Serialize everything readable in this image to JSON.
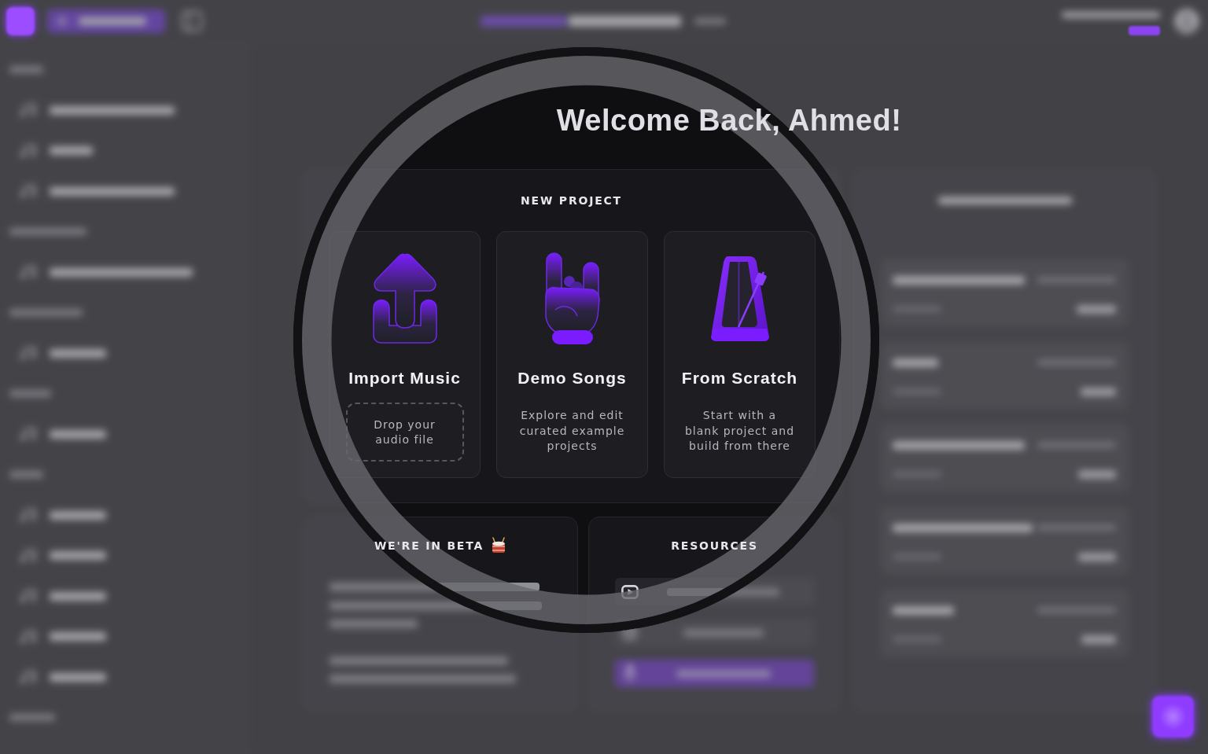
{
  "sidebar": {
    "rows": [
      {
        "kind": "label"
      },
      {
        "kind": "song"
      },
      {
        "kind": "song"
      },
      {
        "kind": "song"
      },
      {
        "kind": "label"
      },
      {
        "kind": "song"
      },
      {
        "kind": "label"
      },
      {
        "kind": "song"
      },
      {
        "kind": "label"
      },
      {
        "kind": "song"
      },
      {
        "kind": "label"
      },
      {
        "kind": "song"
      },
      {
        "kind": "song"
      },
      {
        "kind": "song"
      },
      {
        "kind": "song"
      },
      {
        "kind": "song"
      },
      {
        "kind": "label"
      }
    ]
  },
  "main": {
    "title": "Welcome Back, Ahmed!"
  },
  "new_project": {
    "heading": "NEW PROJECT",
    "options": [
      {
        "kind": "import",
        "title": "Import Music",
        "drop_hint": "Drop your\naudio file"
      },
      {
        "kind": "demo",
        "title": "Demo Songs",
        "description": "Explore and edit\ncurated example\nprojects"
      },
      {
        "kind": "scratch",
        "title": "From Scratch",
        "description": "Start with a\nblank project and\nbuild from there"
      }
    ]
  },
  "beta": {
    "heading": "WE'RE IN BETA"
  },
  "resources": {
    "heading": "RESOURCES",
    "links": [
      {
        "kind": "video"
      },
      {
        "kind": "target"
      },
      {
        "kind": "primary"
      }
    ]
  },
  "recent_projects": {
    "items": [
      {
        "kind": "project"
      },
      {
        "kind": "project"
      },
      {
        "kind": "project"
      },
      {
        "kind": "project"
      },
      {
        "kind": "project"
      }
    ]
  }
}
